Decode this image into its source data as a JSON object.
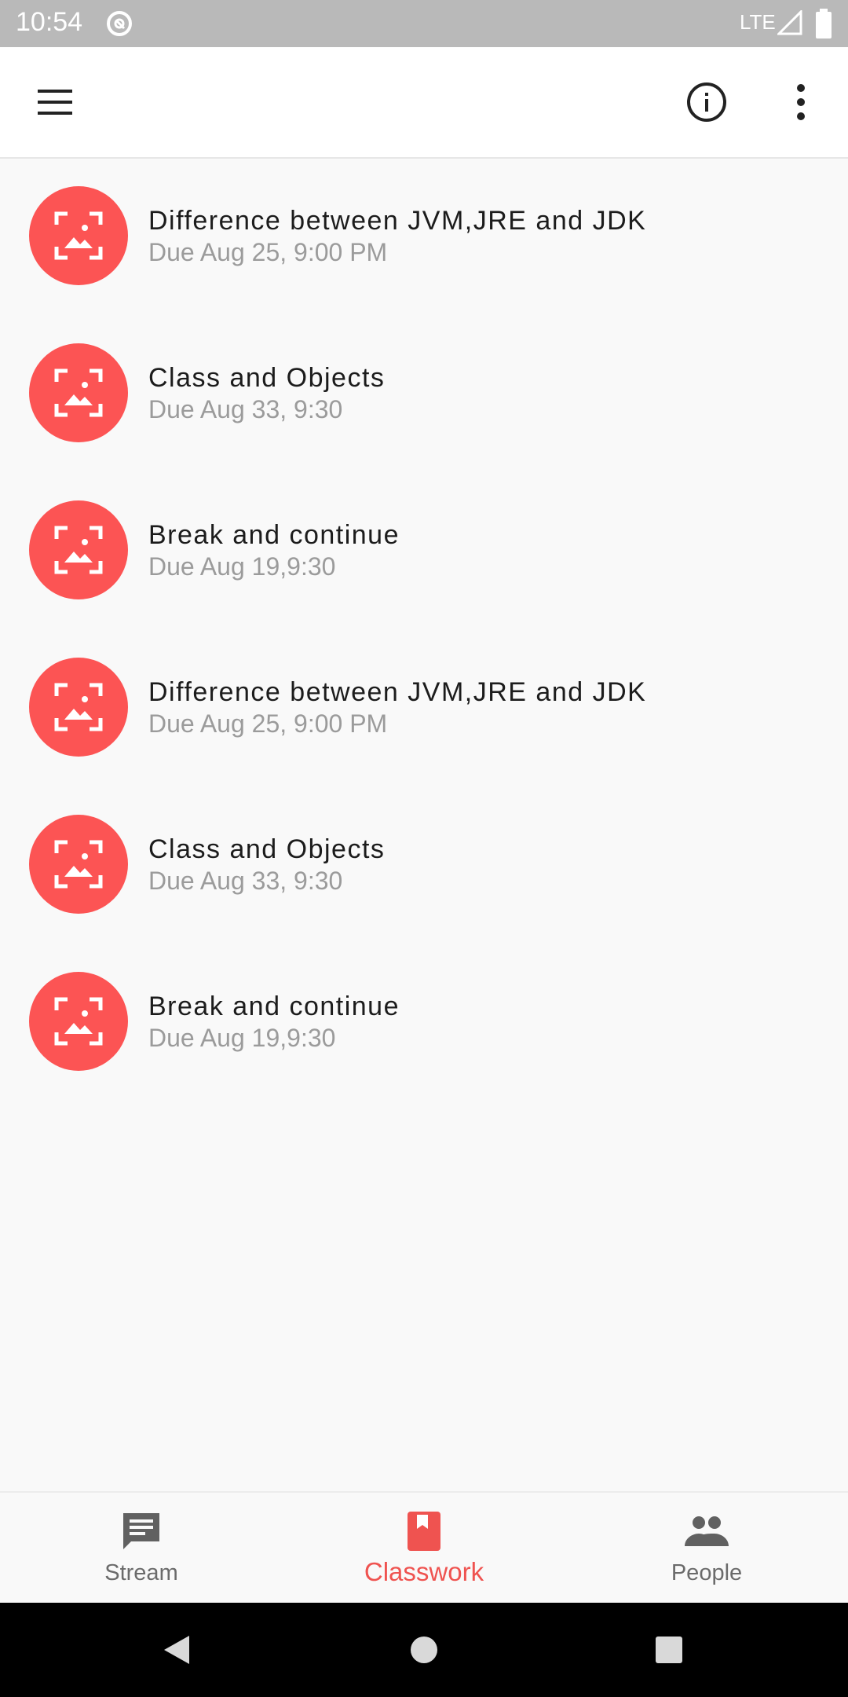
{
  "status_bar": {
    "time": "10:54",
    "network": "LTE"
  },
  "colors": {
    "accent": "#ef5350",
    "avatar": "#fc5454",
    "status_bar": "#b9b9b9"
  },
  "app_bar": {
    "menu_icon": "hamburger-menu-icon",
    "info_icon": "info-icon",
    "more_icon": "more-vert-icon"
  },
  "assignments": [
    {
      "title": "Difference between JVM,JRE and JDK",
      "due": "Due Aug 25, 9:00 PM",
      "icon": "assignment-image-icon"
    },
    {
      "title": "Class and Objects",
      "due": "Due Aug 33, 9:30",
      "icon": "assignment-image-icon"
    },
    {
      "title": "Break and continue",
      "due": "Due Aug 19,9:30",
      "icon": "assignment-image-icon"
    },
    {
      "title": "Difference between JVM,JRE and JDK",
      "due": "Due Aug 25, 9:00 PM",
      "icon": "assignment-image-icon"
    },
    {
      "title": "Class and Objects",
      "due": "Due Aug 33, 9:30",
      "icon": "assignment-image-icon"
    },
    {
      "title": "Break and continue",
      "due": "Due Aug 19,9:30",
      "icon": "assignment-image-icon"
    }
  ],
  "bottom_nav": {
    "items": [
      {
        "label": "Stream",
        "icon": "stream-icon",
        "active": false
      },
      {
        "label": "Classwork",
        "icon": "classwork-icon",
        "active": true
      },
      {
        "label": "People",
        "icon": "people-icon",
        "active": false
      }
    ]
  }
}
